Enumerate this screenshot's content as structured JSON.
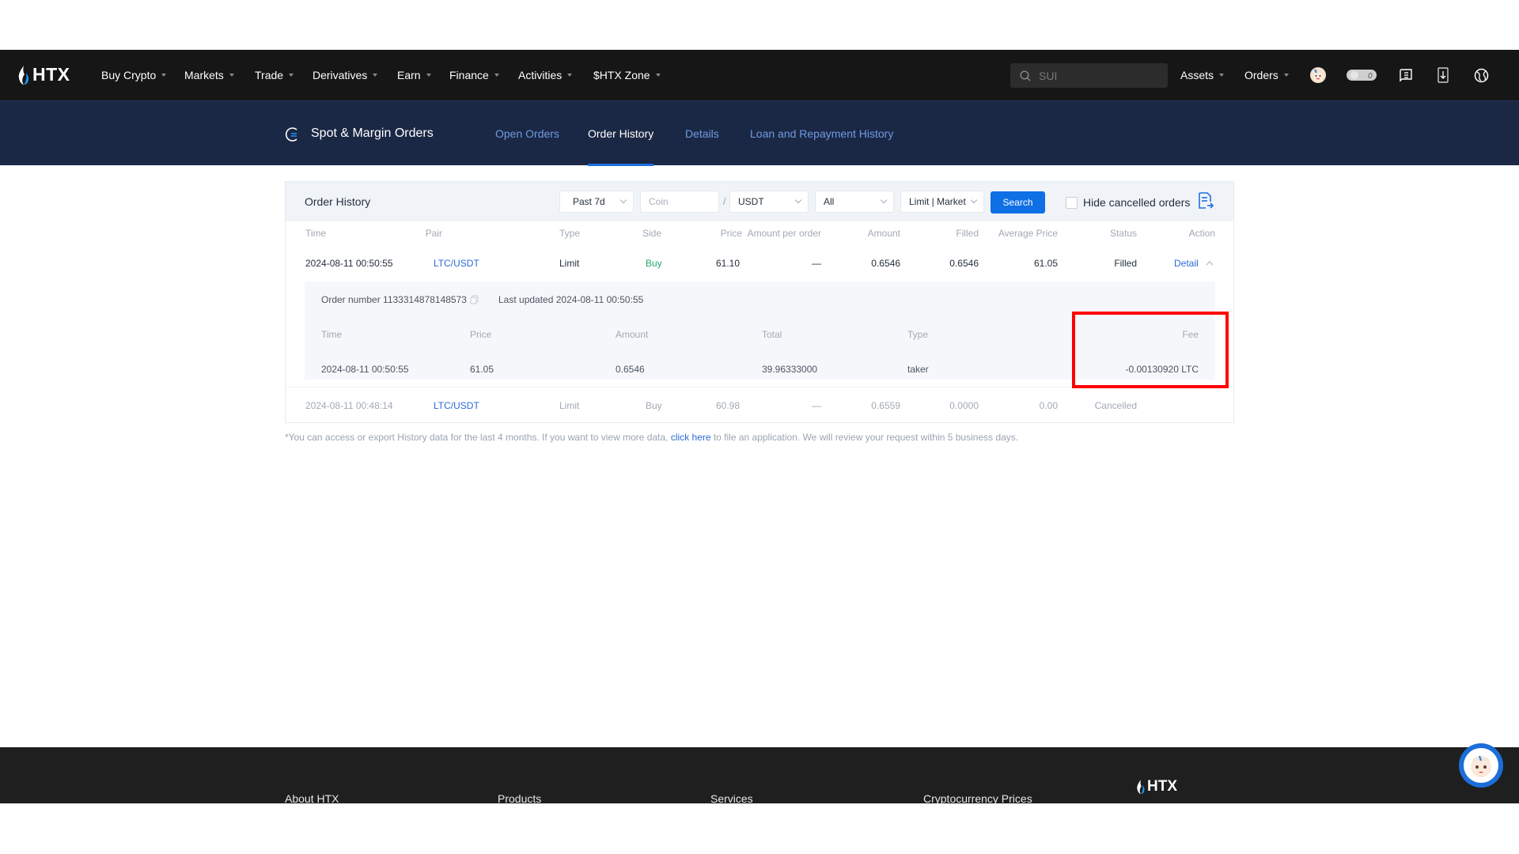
{
  "nav": {
    "logo": "HTX",
    "items": [
      {
        "label": "Buy Crypto"
      },
      {
        "label": "Markets"
      },
      {
        "label": "Trade"
      },
      {
        "label": "Derivatives"
      },
      {
        "label": "Earn"
      },
      {
        "label": "Finance"
      },
      {
        "label": "Activities"
      },
      {
        "label": "$HTX Zone"
      }
    ],
    "search_placeholder": "SUI",
    "assets": "Assets",
    "orders": "Orders",
    "notification_count": "0"
  },
  "subheader": {
    "title": "Spot & Margin Orders",
    "tabs": [
      {
        "label": "Open Orders",
        "active": false
      },
      {
        "label": "Order History",
        "active": true
      },
      {
        "label": "Details",
        "active": false
      },
      {
        "label": "Loan and Repayment History",
        "active": false
      }
    ]
  },
  "panel": {
    "title": "Order History",
    "filters": {
      "period": "Past 7d",
      "coin_placeholder": "Coin",
      "quote": "USDT",
      "side": "All",
      "order_type": "Limit | Market",
      "search_label": "Search",
      "hide_cancelled_label": "Hide cancelled orders",
      "hide_cancelled_checked": false
    },
    "columns": [
      "Time",
      "Pair",
      "Type",
      "Side",
      "Price",
      "Amount per order",
      "Amount",
      "Filled",
      "Average Price",
      "Status",
      "Action"
    ],
    "rows": [
      {
        "time": "2024-08-11 00:50:55",
        "pair": "LTC/USDT",
        "type": "Limit",
        "side": "Buy",
        "price": "61.10",
        "amount_per_order": "—",
        "amount": "0.6546",
        "filled": "0.6546",
        "average_price": "61.05",
        "status": "Filled",
        "action": "Detail",
        "expanded": true,
        "detail": {
          "order_number_label": "Order number",
          "order_number": "1133314878148573",
          "last_updated_label": "Last updated",
          "last_updated": "2024-08-11 00:50:55",
          "columns": [
            "Time",
            "Price",
            "Amount",
            "Total",
            "Type",
            "Fee"
          ],
          "fills": [
            {
              "time": "2024-08-11 00:50:55",
              "price": "61.05",
              "amount": "0.6546",
              "total": "39.96333000",
              "type": "taker",
              "fee": "-0.00130920 LTC"
            }
          ]
        }
      },
      {
        "time": "2024-08-11 00:48:14",
        "pair": "LTC/USDT",
        "type": "Limit",
        "side": "Buy",
        "price": "60.98",
        "amount_per_order": "—",
        "amount": "0.6559",
        "filled": "0.0000",
        "average_price": "0.00",
        "status": "Cancelled",
        "action": ""
      }
    ],
    "note_before": "*You can access or export History data for the last 4 months. If you want to view more data, ",
    "note_link": "click here",
    "note_after": " to file an application. We will review your request within 5 business days."
  },
  "footer": {
    "columns": [
      "About HTX",
      "Products",
      "Services",
      "Cryptocurrency Prices"
    ],
    "logo": "HTX"
  },
  "colors": {
    "nav_bg": "#161616",
    "subheader_bg": "#1b2845",
    "accent": "#0f6fe5",
    "buy": "#27a86b",
    "highlight": "#ff0000"
  }
}
